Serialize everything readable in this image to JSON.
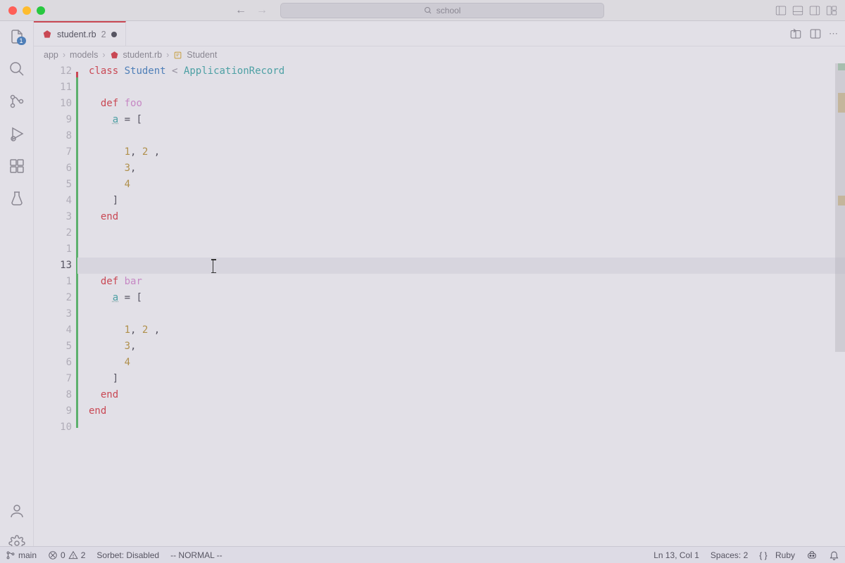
{
  "titlebar": {
    "search_text": "school"
  },
  "tab": {
    "filename": "student.rb",
    "problem_count": "2"
  },
  "breadcrumb": {
    "p1": "app",
    "p2": "models",
    "p3": "student.rb",
    "p4": "Student"
  },
  "activity_badge": "1",
  "gutter_lines": [
    "12",
    "11",
    "10",
    "9",
    "8",
    "7",
    "6",
    "5",
    "4",
    "3",
    "2",
    "1",
    "13",
    "1",
    "2",
    "3",
    "4",
    "5",
    "6",
    "7",
    "8",
    "9",
    "10"
  ],
  "code": {
    "class_kw": "class",
    "class_name": "Student",
    "lt": "<",
    "super": "ApplicationRecord",
    "def_kw": "def",
    "foo": "foo",
    "bar": "bar",
    "end_kw": "end",
    "var_a": "a",
    "eq": " = ",
    "lbr": "[",
    "rbr": "]",
    "n1": "1",
    "n2": "2",
    "n3": "3",
    "n4": "4",
    "comma": ","
  },
  "status": {
    "branch": "main",
    "errors": "0",
    "warnings": "2",
    "sorbet": "Sorbet: Disabled",
    "mode": "-- NORMAL --",
    "pos": "Ln 13, Col 1",
    "spaces": "Spaces: 2",
    "lang_icon": "{ }",
    "lang": "Ruby"
  }
}
